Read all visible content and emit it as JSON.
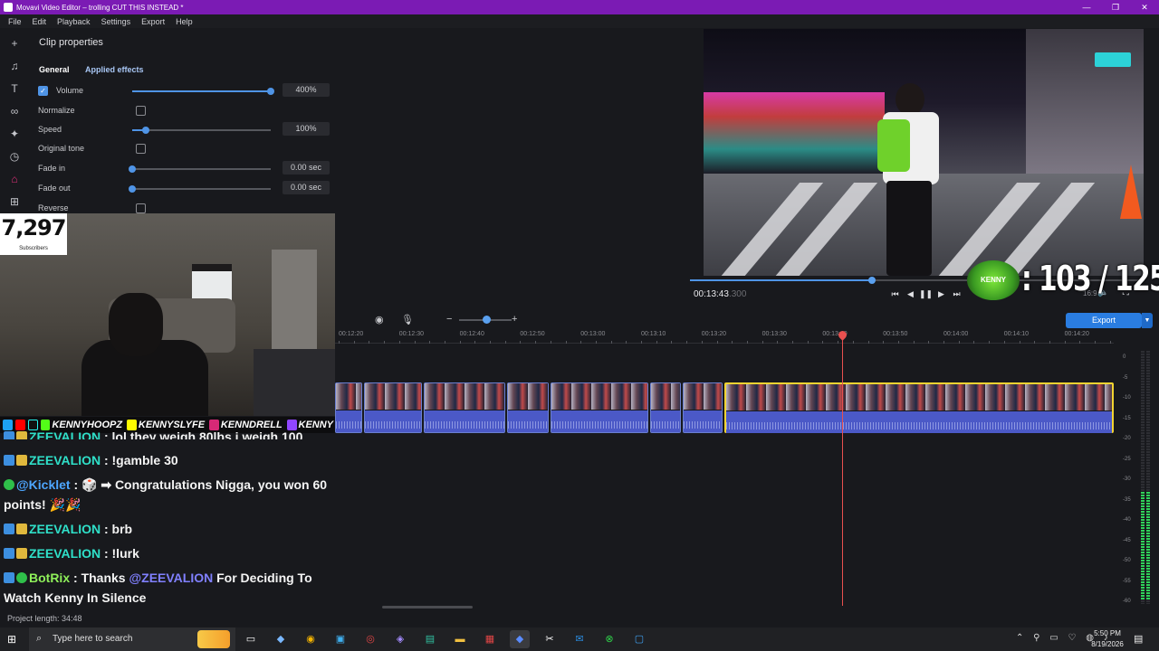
{
  "window": {
    "title": "Movavi Video Editor – trolling CUT THIS INSTEAD *"
  },
  "menu": [
    "File",
    "Edit",
    "Playback",
    "Settings",
    "Export",
    "Help"
  ],
  "tools": [
    "import-icon",
    "music-icon",
    "titles-icon",
    "transitions-icon",
    "filters-icon",
    "stickers-icon",
    "more-tools-icon",
    "apps-icon"
  ],
  "clip_properties": {
    "heading": "Clip properties",
    "tabs": [
      "General",
      "Applied effects"
    ],
    "volume": {
      "label": "Volume",
      "checked": true,
      "value": "400%",
      "level": 1.0
    },
    "normalize": {
      "label": "Normalize",
      "checked": false
    },
    "speed": {
      "label": "Speed",
      "value": "100%",
      "level": 0.1
    },
    "original_tone": {
      "label": "Original tone",
      "checked": false
    },
    "fade_in": {
      "label": "Fade in",
      "value": "0.00 sec",
      "level": 0
    },
    "fade_out": {
      "label": "Fade out",
      "value": "0.00 sec",
      "level": 0
    },
    "reverse": {
      "label": "Reverse",
      "checked": false
    }
  },
  "player": {
    "timecode": "00:13:43",
    "timecode_ms": ".300",
    "progress": 0.4,
    "aspect": "16:9"
  },
  "overlay": {
    "score": ": 103 / 125",
    "logo_text": "KENNY",
    "subscribers": "7,297",
    "subscribers_label": "Subscribers",
    "socials": [
      "KENNYHOOPZ",
      "KENNYSLYFE",
      "KENNDRELL",
      "KENNY"
    ]
  },
  "chat": [
    {
      "user": "ZEEVALION",
      "text": " : lol they weigh 80lbs i weigh 100"
    },
    {
      "user": "ZEEVALION",
      "text": " : !gamble 30"
    },
    {
      "user": "@Kicklet",
      "text": " : 🎲 ➡ Congratulations Nigga, you won 60 points! 🎉🎉"
    },
    {
      "user": "ZEEVALION",
      "text": " : brb"
    },
    {
      "user": "ZEEVALION",
      "text": " : !lurk"
    },
    {
      "user": "BotRix",
      "text": " : Thanks ",
      "mention": "@ZEEVALION",
      "text2": " For Deciding To Watch Kenny In Silence"
    }
  ],
  "timeline": {
    "export_label": "Export",
    "ticks": [
      "00:12:20",
      "00:12:30",
      "00:12:40",
      "00:12:50",
      "00:13:00",
      "00:13:10",
      "00:13:20",
      "00:13:30",
      "00:13:40",
      "00:13:50",
      "00:14:00",
      "00:14:10",
      "00:14:20"
    ],
    "meter_labels": [
      "0",
      "-5",
      "-10",
      "-15",
      "-20",
      "-25",
      "-30",
      "-35",
      "-40",
      "-45",
      "-50",
      "-55",
      "-60"
    ]
  },
  "status": {
    "project_length": "Project length: 34:48"
  },
  "taskbar": {
    "search_placeholder": "Type here to search",
    "time": "5:50 PM",
    "date": "8/19/2026"
  },
  "colors": {
    "accent": "#4f94e6",
    "title_bar": "#7b1bb4",
    "playhead": "#e8504f",
    "selected_clip": "#f3d431"
  }
}
